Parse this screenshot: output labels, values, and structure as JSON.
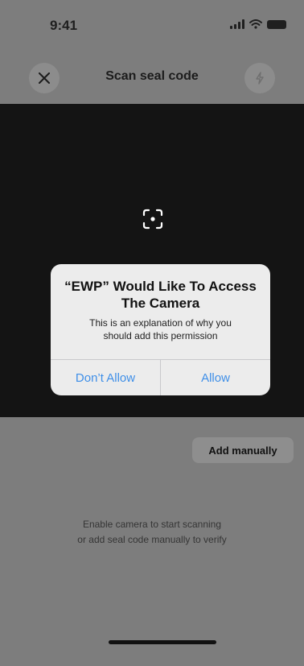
{
  "status_bar": {
    "time": "9:41",
    "icons": [
      "cellular-signal-icon",
      "wifi-icon",
      "battery-icon"
    ]
  },
  "nav": {
    "title": "Scan seal code",
    "close_icon": "close-icon",
    "flash_icon": "flash-icon"
  },
  "camera": {
    "focus_icon": "focus-scan-icon"
  },
  "permission_alert": {
    "title_line1": "“EWP” Would Like To Access",
    "title_line2": "The Camera",
    "message_line1": "This is an explanation of why you",
    "message_line2": "should add this permission",
    "deny_label": "Don’t Allow",
    "allow_label": "Allow"
  },
  "add_manually_label": "Add manually",
  "hint": {
    "line1": "Enable camera to start scanning",
    "line2": "or add seal code manually to verify"
  },
  "colors": {
    "dimmed_background": "#7d7d7d",
    "camera_background": "#141414",
    "alert_background": "#ececec",
    "alert_button_text": "#3f8fe8"
  }
}
